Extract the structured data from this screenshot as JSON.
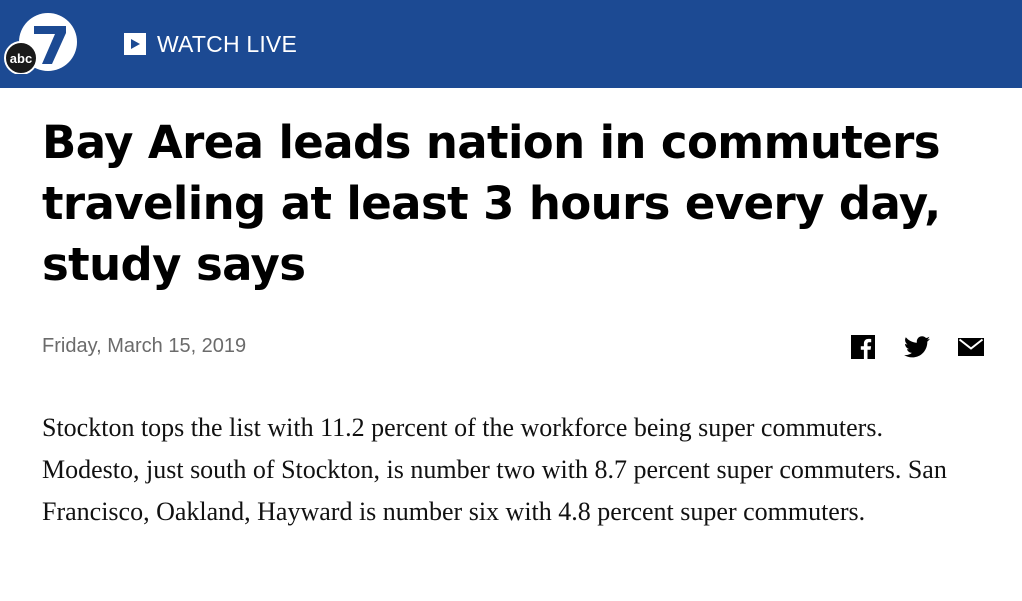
{
  "header": {
    "logo_text": "abc",
    "logo_number": "7",
    "watch_live_label": "WATCH LIVE",
    "background_color": "#1c4a93"
  },
  "article": {
    "headline": "Bay Area leads nation in commuters traveling at least 3 hours every day, study says",
    "date": "Friday, March 15, 2019",
    "body": "Stockton tops the list with 11.2 percent of the workforce being super commuters. Modesto, just south of Stockton, is number two with 8.7 percent super commuters. San Francisco, Oakland, Hayward is number six with 4.8 percent super commuters."
  },
  "share": {
    "icons": [
      "facebook-icon",
      "twitter-icon",
      "email-icon"
    ]
  }
}
